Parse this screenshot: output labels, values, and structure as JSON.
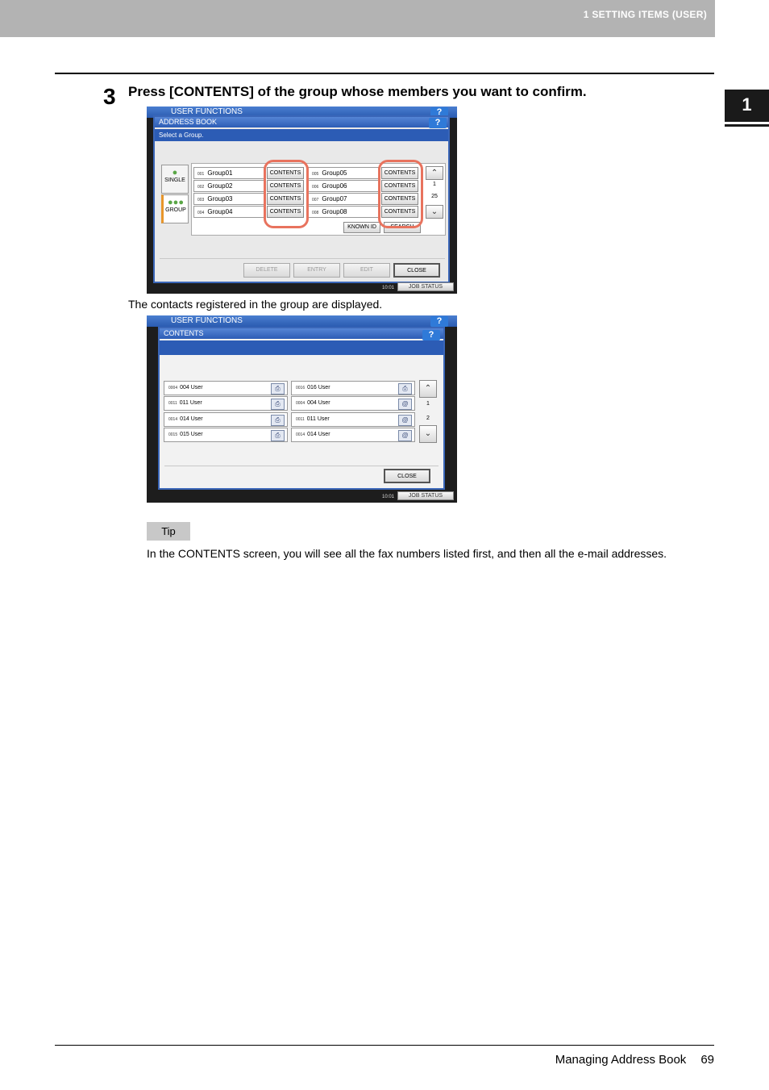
{
  "header": {
    "section": "1 SETTING ITEMS (USER)",
    "chapter_tab": "1"
  },
  "step": {
    "number": "3",
    "text": "Press [CONTENTS] of the group whose members you want to confirm."
  },
  "caption": "The contacts registered in the group are displayed.",
  "tip": {
    "label": "Tip",
    "text": "In the CONTENTS screen, you will see all the fax numbers listed first, and then all the e-mail addresses."
  },
  "footer": {
    "title": "Managing Address Book",
    "page": "69"
  },
  "screen1": {
    "title": "USER FUNCTIONS",
    "help": "?",
    "panel_title": "ADDRESS BOOK",
    "subtitle": "Select a Group.",
    "side": {
      "single": "SINGLE",
      "group": "GROUP"
    },
    "groups": [
      {
        "num": "001",
        "name": "Group01",
        "btn": "CONTENTS"
      },
      {
        "num": "002",
        "name": "Group02",
        "btn": "CONTENTS"
      },
      {
        "num": "003",
        "name": "Group03",
        "btn": "CONTENTS"
      },
      {
        "num": "004",
        "name": "Group04",
        "btn": "CONTENTS"
      },
      {
        "num": "005",
        "name": "Group05",
        "btn": "CONTENTS"
      },
      {
        "num": "006",
        "name": "Group06",
        "btn": "CONTENTS"
      },
      {
        "num": "007",
        "name": "Group07",
        "btn": "CONTENTS"
      },
      {
        "num": "008",
        "name": "Group08",
        "btn": "CONTENTS"
      }
    ],
    "page_current": "1",
    "page_total": "25",
    "known_id": "KNOWN ID",
    "search": "SEARCH",
    "delete": "DELETE",
    "entry": "ENTRY",
    "edit": "EDIT",
    "close": "CLOSE",
    "job_status": "JOB STATUS",
    "clock": "10:01"
  },
  "screen2": {
    "title": "USER FUNCTIONS",
    "help": "?",
    "panel_title": "CONTENTS",
    "contacts": [
      {
        "num": "0004",
        "name": "004 User",
        "icon": "fax-icon"
      },
      {
        "num": "0011",
        "name": "011 User",
        "icon": "fax-icon"
      },
      {
        "num": "0014",
        "name": "014 User",
        "icon": "fax-icon"
      },
      {
        "num": "0015",
        "name": "015 User",
        "icon": "fax-icon"
      },
      {
        "num": "0016",
        "name": "016 User",
        "icon": "fax-icon"
      },
      {
        "num": "0004",
        "name": "004 User",
        "icon": "email-icon"
      },
      {
        "num": "0011",
        "name": "011 User",
        "icon": "email-icon"
      },
      {
        "num": "0014",
        "name": "014 User",
        "icon": "email-icon"
      }
    ],
    "page_current": "1",
    "page_total": "2",
    "close": "CLOSE",
    "job_status": "JOB STATUS",
    "clock": "10:01"
  },
  "colors": {
    "highlight": "#e8735e",
    "title_blue": "#2c5cb5"
  }
}
